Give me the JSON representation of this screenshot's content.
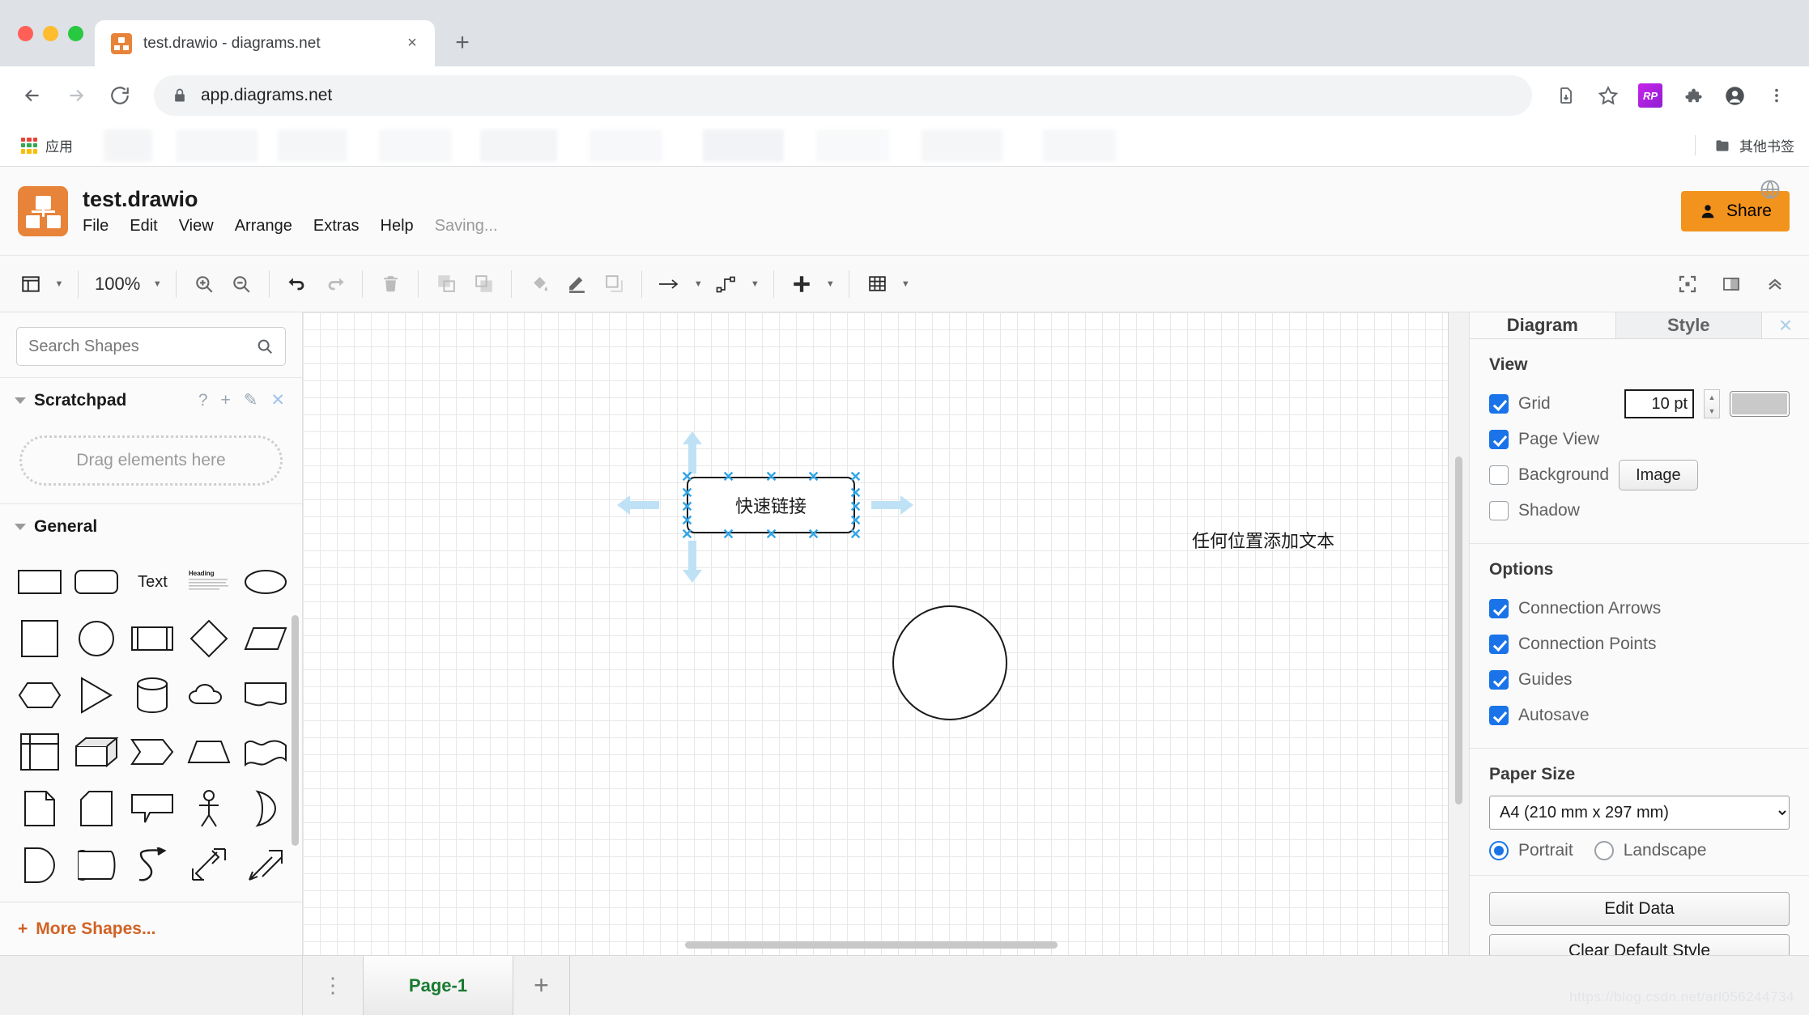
{
  "browser": {
    "tab": {
      "title": "test.drawio - diagrams.net",
      "favicon": "drawio-favicon",
      "close": "×"
    },
    "new_tab": "+",
    "nav": {
      "back": "←",
      "forward": "→",
      "reload": "↻"
    },
    "omnibox": {
      "url": "app.diagrams.net",
      "lock": "lock-icon"
    },
    "toolbar_icons": [
      "install-icon",
      "bookmark-star-icon",
      "rp-extension-icon",
      "extensions-puzzle-icon",
      "profile-avatar-icon",
      "chrome-menu-icon"
    ],
    "extension_label": "RP",
    "bookmarks": {
      "apps_label": "应用",
      "other_label": "其他书签"
    }
  },
  "app": {
    "file_title": "test.drawio",
    "menu": [
      "File",
      "Edit",
      "View",
      "Arrange",
      "Extras",
      "Help"
    ],
    "status": "Saving...",
    "share_label": "Share",
    "globe": "globe-icon"
  },
  "toolbar": {
    "zoom_level": "100%",
    "buttons": [
      "view-panel",
      "zoom-in",
      "zoom-out",
      "undo",
      "redo",
      "delete",
      "to-front",
      "to-back",
      "fill-color",
      "line-color",
      "shadow",
      "arrow-style",
      "waypoints",
      "insert",
      "table"
    ],
    "right_buttons": [
      "fullscreen-icon",
      "format-panel-icon",
      "collapse-toolbar-icon"
    ]
  },
  "shapes_panel": {
    "search_placeholder": "Search Shapes",
    "search_value": "",
    "search_icon": "search-icon",
    "scratchpad": {
      "title": "Scratchpad",
      "actions": [
        "?",
        "+",
        "✎",
        "✕"
      ],
      "dropzone_text": "Drag elements here"
    },
    "general": {
      "title": "General"
    },
    "more_shapes": "More Shapes..."
  },
  "canvas": {
    "shape_label": "快速链接",
    "free_text": "任何位置添加文本",
    "circle": "ellipse-shape"
  },
  "format": {
    "tabs": [
      {
        "label": "Diagram",
        "active": true
      },
      {
        "label": "Style",
        "active": false
      }
    ],
    "close": "×",
    "view": {
      "heading": "View",
      "grid": {
        "label": "Grid",
        "checked": true,
        "size": "10 pt",
        "color": "#c9c9c9"
      },
      "page_view": {
        "label": "Page View",
        "checked": true
      },
      "background": {
        "label": "Background",
        "checked": false,
        "button": "Image"
      },
      "shadow": {
        "label": "Shadow",
        "checked": false
      }
    },
    "options": {
      "heading": "Options",
      "items": [
        {
          "label": "Connection Arrows",
          "checked": true
        },
        {
          "label": "Connection Points",
          "checked": true
        },
        {
          "label": "Guides",
          "checked": true
        },
        {
          "label": "Autosave",
          "checked": true
        }
      ]
    },
    "paper": {
      "heading": "Paper Size",
      "selected": "A4 (210 mm x 297 mm)",
      "orientation": [
        {
          "label": "Portrait",
          "selected": true
        },
        {
          "label": "Landscape",
          "selected": false
        }
      ]
    },
    "actions": [
      "Edit Data",
      "Clear Default Style"
    ]
  },
  "footer": {
    "page_tab": "Page-1",
    "add_page": "+",
    "menu_icon": "page-menu-icon",
    "watermark": "https://blog.csdn.net/arl056244734"
  },
  "colors": {
    "accent_orange": "#f2931e",
    "checkbox_blue": "#1a73e8",
    "page_tab_green": "#1a7a31",
    "more_shapes_orange": "#d06224"
  }
}
